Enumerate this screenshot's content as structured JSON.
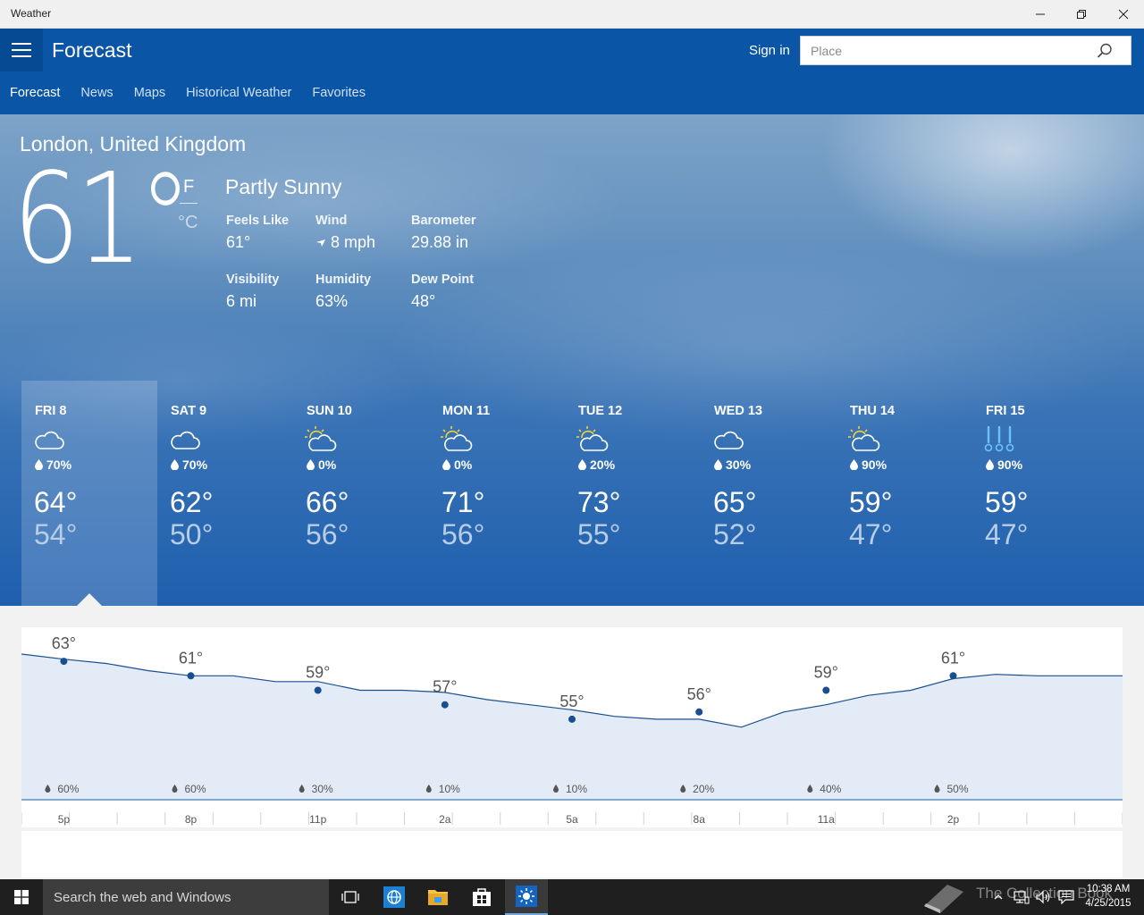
{
  "window": {
    "title": "Weather"
  },
  "header": {
    "title": "Forecast",
    "sign_in": "Sign in",
    "search_placeholder": "Place",
    "tabs": [
      "Forecast",
      "News",
      "Maps",
      "Historical Weather",
      "Favorites"
    ],
    "active_tab": "Forecast",
    "colors": {
      "header": "#0a55a5",
      "hamburger_bg": "#064a93"
    }
  },
  "current": {
    "location": "London, United Kingdom",
    "temp": "61°",
    "unit_f": "F",
    "unit_c": "°C",
    "condition": "Partly Sunny",
    "details": [
      {
        "label": "Feels Like",
        "value": "61°"
      },
      {
        "label": "Wind",
        "value": "8 mph"
      },
      {
        "label": "Barometer",
        "value": "29.88 in"
      },
      {
        "label": "Visibility",
        "value": "6 mi"
      },
      {
        "label": "Humidity",
        "value": "63%"
      },
      {
        "label": "Dew Point",
        "value": "48°"
      }
    ],
    "wind_icon": "wind-direction-arrow-icon"
  },
  "daily": [
    {
      "day": "FRI 8",
      "icon": "cloudy-icon",
      "precip": "70%",
      "hi": "64°",
      "lo": "54°",
      "selected": true
    },
    {
      "day": "SAT 9",
      "icon": "cloudy-icon",
      "precip": "70%",
      "hi": "62°",
      "lo": "50°"
    },
    {
      "day": "SUN 10",
      "icon": "partly-sunny-icon",
      "precip": "0%",
      "hi": "66°",
      "lo": "56°"
    },
    {
      "day": "MON 11",
      "icon": "partly-sunny-icon",
      "precip": "0%",
      "hi": "71°",
      "lo": "56°"
    },
    {
      "day": "TUE 12",
      "icon": "partly-sunny-icon",
      "precip": "20%",
      "hi": "73°",
      "lo": "55°"
    },
    {
      "day": "WED 13",
      "icon": "cloudy-icon",
      "precip": "30%",
      "hi": "65°",
      "lo": "52°"
    },
    {
      "day": "THU 14",
      "icon": "partly-sunny-icon",
      "precip": "90%",
      "hi": "59°",
      "lo": "47°"
    },
    {
      "day": "FRI 15",
      "icon": "rain-icon",
      "precip": "90%",
      "hi": "59°",
      "lo": "47°"
    }
  ],
  "hourly": {
    "labels": [
      {
        "time": "5p",
        "temp": "63°",
        "precip": "60%"
      },
      {
        "time": "8p",
        "temp": "61°",
        "precip": "60%"
      },
      {
        "time": "11p",
        "temp": "59°",
        "precip": "30%"
      },
      {
        "time": "2a",
        "temp": "57°",
        "precip": "10%"
      },
      {
        "time": "5a",
        "temp": "55°",
        "precip": "10%"
      },
      {
        "time": "8a",
        "temp": "56°",
        "precip": "20%"
      },
      {
        "time": "11a",
        "temp": "59°",
        "precip": "40%"
      },
      {
        "time": "2p",
        "temp": "61°",
        "precip": "50%"
      }
    ],
    "line_temps": [
      64,
      63.3,
      62.7,
      61.7,
      61,
      61,
      60.2,
      60.2,
      59,
      59,
      58.7,
      57.7,
      57,
      56.3,
      55.4,
      55,
      55,
      53.9,
      56,
      57,
      58.3,
      59,
      60.6,
      61.2,
      61,
      61,
      61
    ]
  },
  "taskbar": {
    "search_text": "Search the web and Windows",
    "time": "10:38 AM",
    "date": "4/25/2015",
    "watermark": "The Collection Book"
  }
}
